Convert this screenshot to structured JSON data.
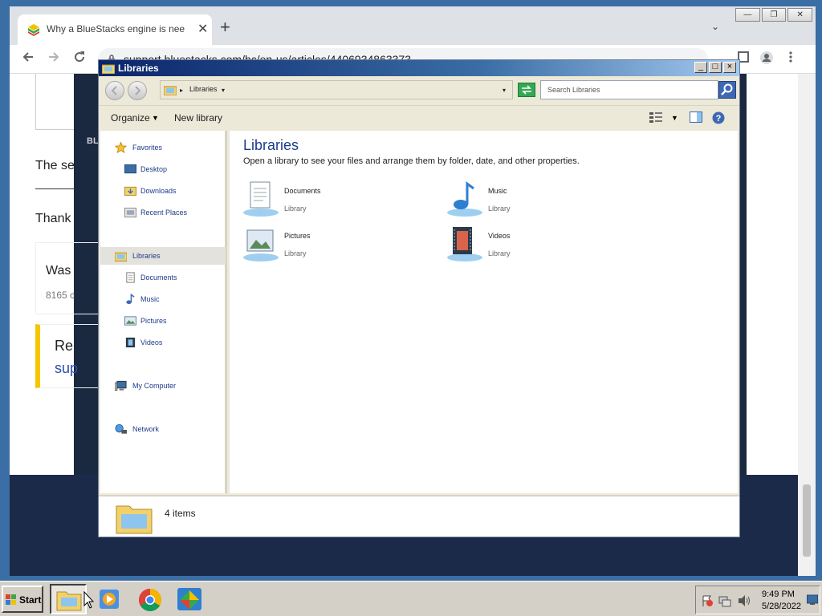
{
  "browser": {
    "tab_title": "Why a BlueStacks engine is needed",
    "tab_close": "✕",
    "new_tab": "+",
    "tab_search": "⌄",
    "url": "support.bluestacks.com/hc/en-us/articles/4406934863373",
    "win_min": "—",
    "win_max": "❐",
    "win_close": "✕"
  },
  "page": {
    "text_1": "The se",
    "text_2": "Thank",
    "was_text": "Was",
    "count_text": "8165 c",
    "related_text": "Re",
    "related_link": "sup",
    "partial_logo": "BL"
  },
  "explorer": {
    "title": "Libraries",
    "address_crumb": "Libraries",
    "search_placeholder": "Search Libraries",
    "commands": {
      "organize": "Organize",
      "new_library": "New library"
    },
    "nav": {
      "favorites": "Favorites",
      "desktop": "Desktop",
      "downloads": "Downloads",
      "recent": "Recent Places",
      "libraries": "Libraries",
      "documents": "Documents",
      "music": "Music",
      "pictures": "Pictures",
      "videos": "Videos",
      "computer": "My Computer",
      "network": "Network"
    },
    "main_title": "Libraries",
    "main_subtitle": "Open a library to see your files and arrange them by folder, date, and other properties.",
    "libraries": [
      {
        "name": "Documents",
        "type": "Library"
      },
      {
        "name": "Music",
        "type": "Library"
      },
      {
        "name": "Pictures",
        "type": "Library"
      },
      {
        "name": "Videos",
        "type": "Library"
      }
    ],
    "status": "4 items"
  },
  "taskbar": {
    "start": "Start",
    "time": "9:49 PM",
    "date": "5/28/2022"
  },
  "colors": {
    "titlebar": "#0a246a",
    "chrome_tabbar": "#dee1e6",
    "accent_link": "#1a3c8a"
  }
}
